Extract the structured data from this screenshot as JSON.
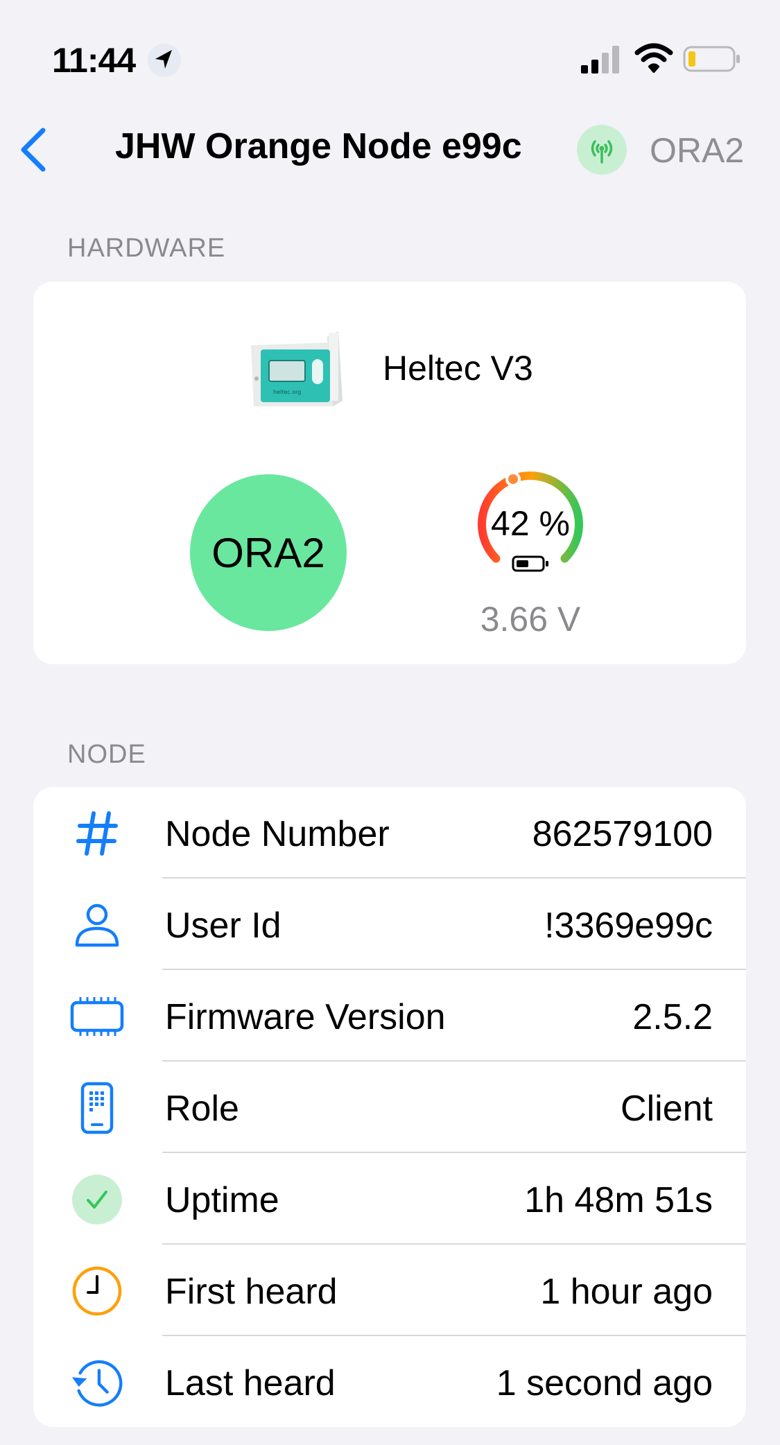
{
  "status_bar": {
    "time": "11:44"
  },
  "nav": {
    "title": "JHW Orange Node e99c",
    "short_name": "ORA2"
  },
  "hardware": {
    "header": "HARDWARE",
    "model": "Heltec V3",
    "device_label": "heltec.org",
    "short_name": "ORA2",
    "battery_percent_text": "42 %",
    "battery_level": 0.42,
    "voltage": "3.66 V"
  },
  "node": {
    "header": "NODE",
    "rows": [
      {
        "icon": "hashtag-icon",
        "label": "Node Number",
        "value": "862579100"
      },
      {
        "icon": "person-icon",
        "label": "User Id",
        "value": "!3369e99c"
      },
      {
        "icon": "cpu-chip-icon",
        "label": "Firmware Version",
        "value": "2.5.2"
      },
      {
        "icon": "device-role-icon",
        "label": "Role",
        "value": "Client"
      },
      {
        "icon": "checkmark-circle-icon",
        "label": "Uptime",
        "value": "1h 48m 51s"
      },
      {
        "icon": "clock-icon",
        "label": "First heard",
        "value": "1 hour ago"
      },
      {
        "icon": "history-icon",
        "label": "Last heard",
        "value": "1 second ago"
      }
    ]
  },
  "colors": {
    "accent": "#147efb",
    "short_name_bg": "#6ae79e",
    "separator": "#d8d8dc",
    "background": "#f2f2f7"
  }
}
